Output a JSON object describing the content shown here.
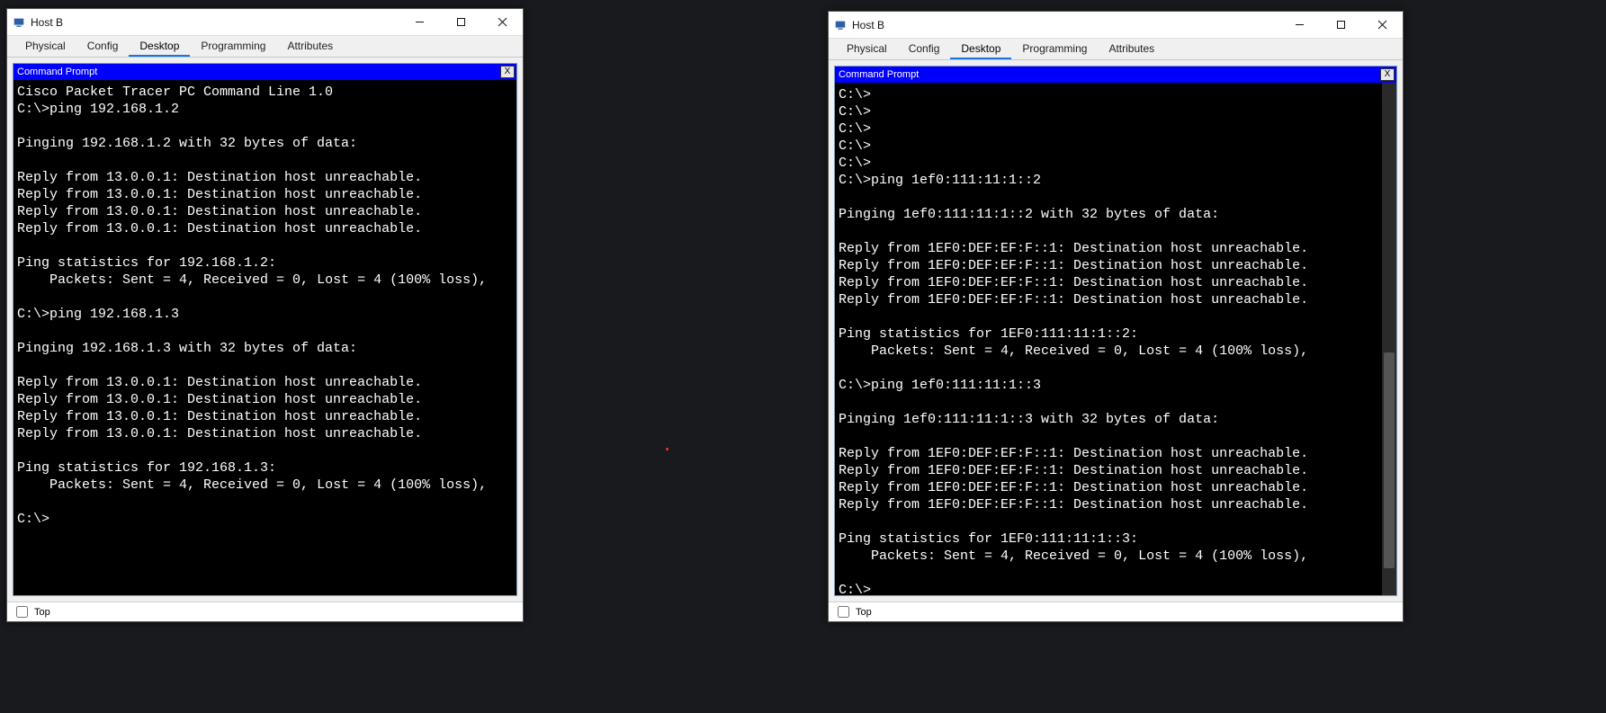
{
  "left": {
    "title": "Host B",
    "tabs": [
      "Physical",
      "Config",
      "Desktop",
      "Programming",
      "Attributes"
    ],
    "activeTab": 2,
    "cmdTitle": "Command Prompt",
    "cmdClose": "X",
    "terminal": "Cisco Packet Tracer PC Command Line 1.0\nC:\\>ping 192.168.1.2\n\nPinging 192.168.1.2 with 32 bytes of data:\n\nReply from 13.0.0.1: Destination host unreachable.\nReply from 13.0.0.1: Destination host unreachable.\nReply from 13.0.0.1: Destination host unreachable.\nReply from 13.0.0.1: Destination host unreachable.\n\nPing statistics for 192.168.1.2:\n    Packets: Sent = 4, Received = 0, Lost = 4 (100% loss),\n\nC:\\>ping 192.168.1.3\n\nPinging 192.168.1.3 with 32 bytes of data:\n\nReply from 13.0.0.1: Destination host unreachable.\nReply from 13.0.0.1: Destination host unreachable.\nReply from 13.0.0.1: Destination host unreachable.\nReply from 13.0.0.1: Destination host unreachable.\n\nPing statistics for 192.168.1.3:\n    Packets: Sent = 4, Received = 0, Lost = 4 (100% loss),\n\nC:\\>",
    "topLabel": "Top"
  },
  "right": {
    "title": "Host B",
    "tabs": [
      "Physical",
      "Config",
      "Desktop",
      "Programming",
      "Attributes"
    ],
    "activeTab": 2,
    "cmdTitle": "Command Prompt",
    "cmdClose": "X",
    "terminal": "C:\\>\nC:\\>\nC:\\>\nC:\\>\nC:\\>\nC:\\>ping 1ef0:111:11:1::2\n\nPinging 1ef0:111:11:1::2 with 32 bytes of data:\n\nReply from 1EF0:DEF:EF:F::1: Destination host unreachable.\nReply from 1EF0:DEF:EF:F::1: Destination host unreachable.\nReply from 1EF0:DEF:EF:F::1: Destination host unreachable.\nReply from 1EF0:DEF:EF:F::1: Destination host unreachable.\n\nPing statistics for 1EF0:111:11:1::2:\n    Packets: Sent = 4, Received = 0, Lost = 4 (100% loss),\n\nC:\\>ping 1ef0:111:11:1::3\n\nPinging 1ef0:111:11:1::3 with 32 bytes of data:\n\nReply from 1EF0:DEF:EF:F::1: Destination host unreachable.\nReply from 1EF0:DEF:EF:F::1: Destination host unreachable.\nReply from 1EF0:DEF:EF:F::1: Destination host unreachable.\nReply from 1EF0:DEF:EF:F::1: Destination host unreachable.\n\nPing statistics for 1EF0:111:11:1::3:\n    Packets: Sent = 4, Received = 0, Lost = 4 (100% loss),\n\nC:\\>",
    "topLabel": "Top"
  }
}
